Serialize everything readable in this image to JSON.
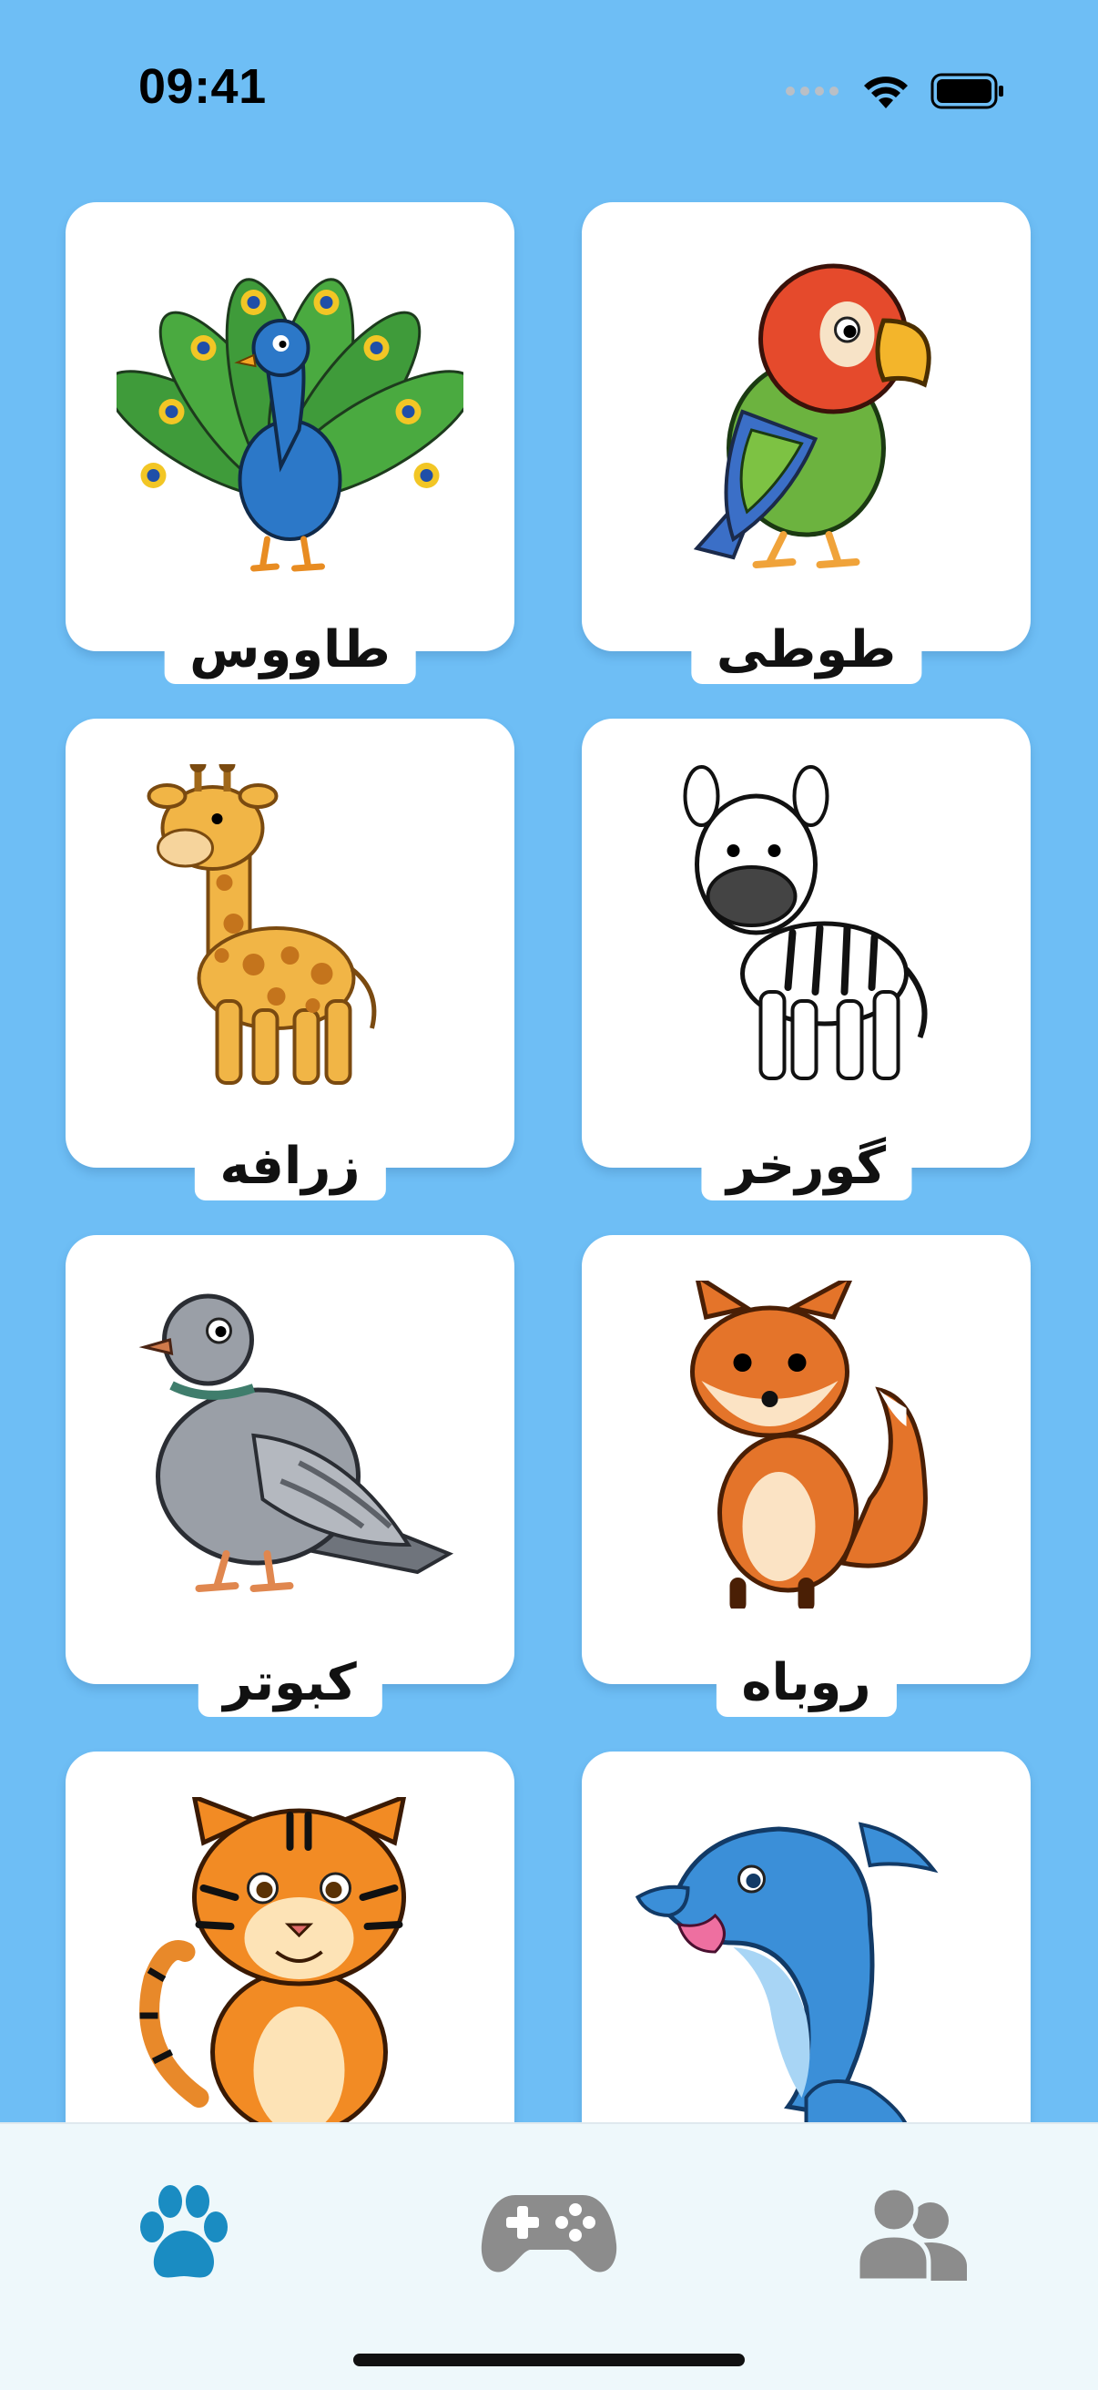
{
  "status_bar": {
    "time": "09:41"
  },
  "animals": [
    {
      "name": "طاووس",
      "icon": "peacock-icon"
    },
    {
      "name": "طوطی",
      "icon": "parrot-icon"
    },
    {
      "name": "زرافه",
      "icon": "giraffe-icon"
    },
    {
      "name": "گورخر",
      "icon": "zebra-icon"
    },
    {
      "name": "کبوتر",
      "icon": "pigeon-icon"
    },
    {
      "name": "روباه",
      "icon": "fox-icon"
    },
    {
      "name": "",
      "icon": "tiger-icon"
    },
    {
      "name": "",
      "icon": "dolphin-icon"
    }
  ],
  "tab_bar": {
    "tabs": [
      {
        "icon": "paw-icon",
        "active": true
      },
      {
        "icon": "gamepad-icon",
        "active": false
      },
      {
        "icon": "users-icon",
        "active": false
      }
    ],
    "active_color": "#1A8CC2",
    "inactive_color": "#8C8C8C"
  },
  "colors": {
    "background": "#6EBEF5",
    "card": "#FFFFFF",
    "tab_bar": "#EEF8FB"
  }
}
